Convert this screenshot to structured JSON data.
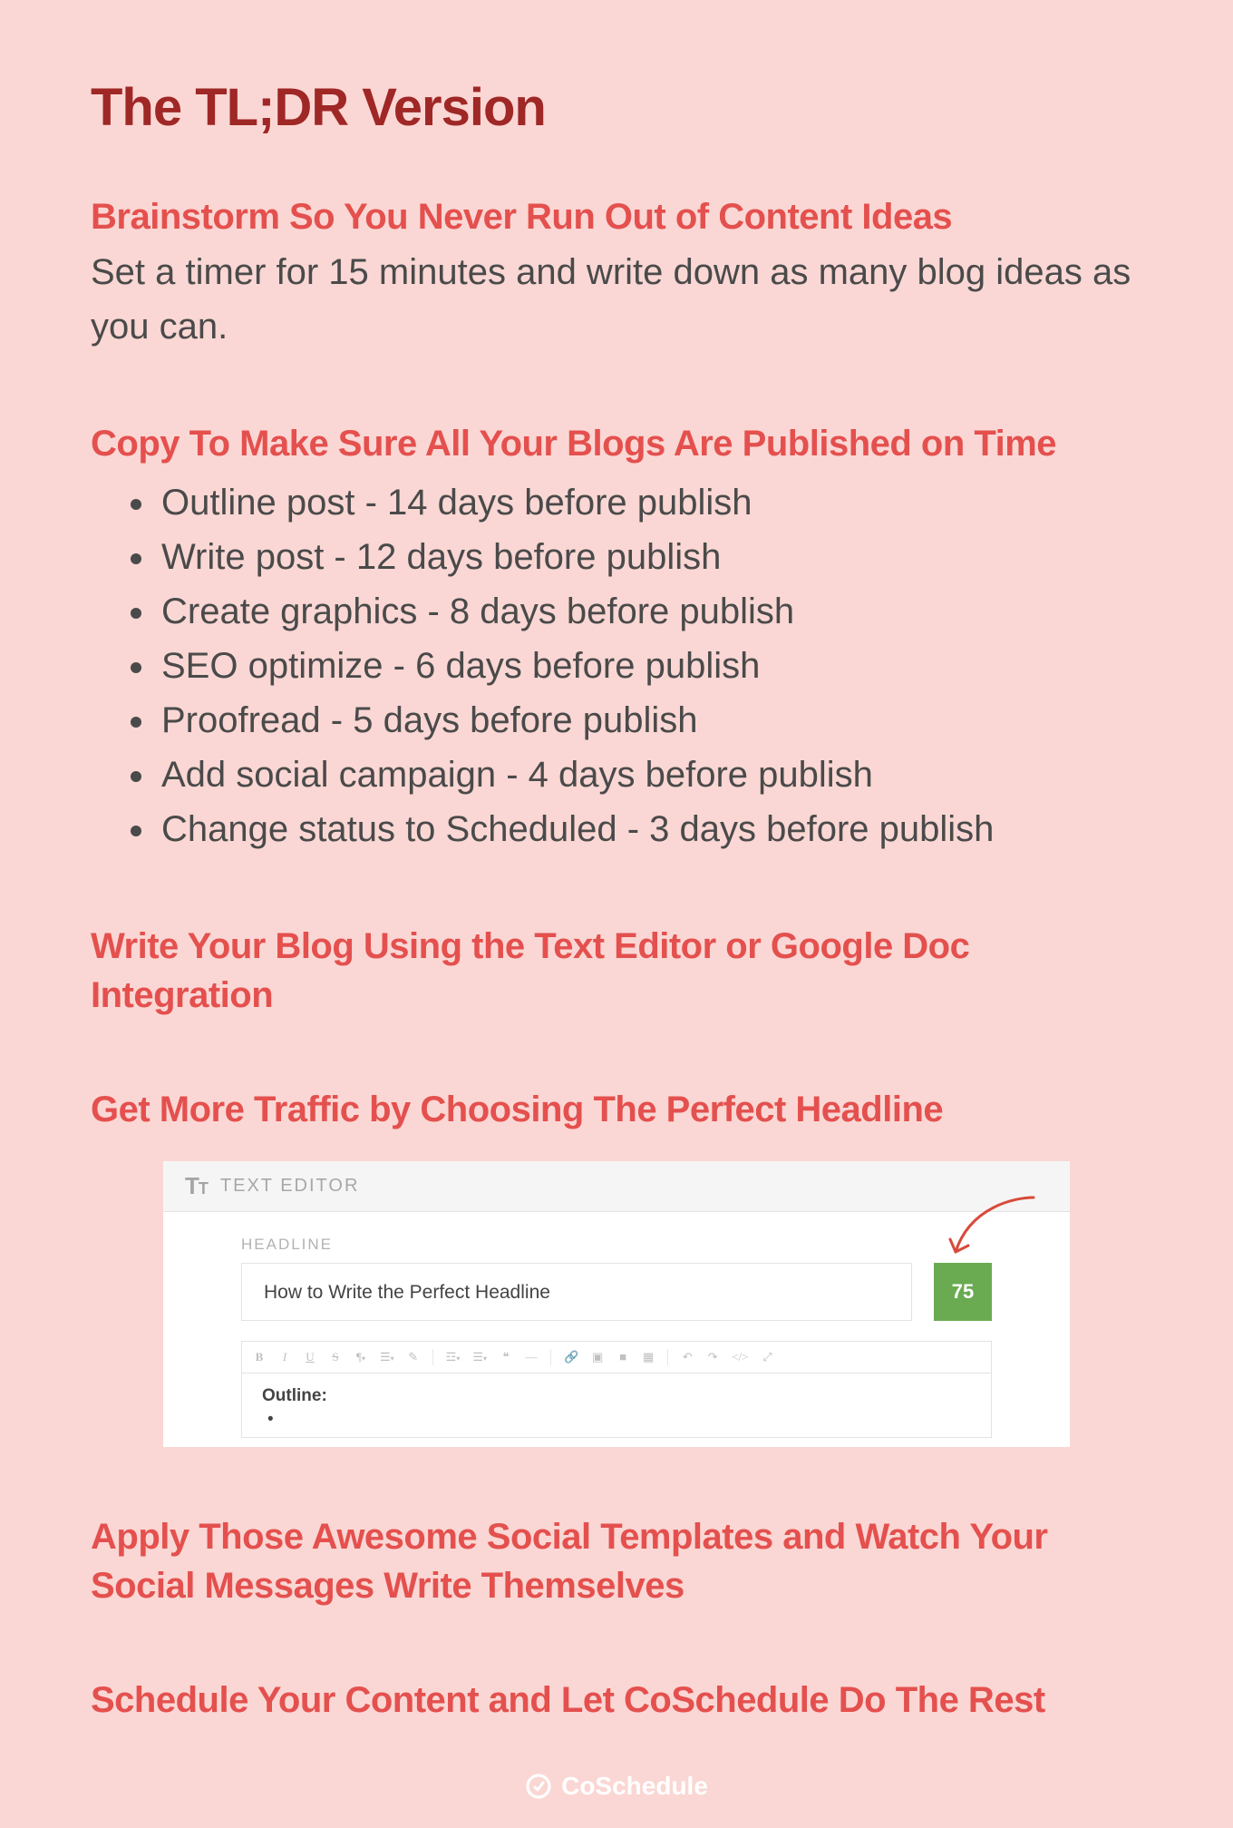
{
  "title": "The TL;DR Version",
  "sections": [
    {
      "heading": "Brainstorm So You Never Run Out of Content Ideas",
      "body": "Set a timer for 15 minutes and write down as many blog ideas as you can."
    },
    {
      "heading": "Copy To Make Sure All Your Blogs Are Published on Time",
      "list": [
        "Outline post - 14 days before publish",
        "Write post - 12 days before publish",
        "Create graphics - 8 days before publish",
        "SEO optimize - 6 days before publish",
        "Proofread - 5 days before publish",
        "Add social campaign - 4 days before publish",
        "Change status to Scheduled - 3 days before publish"
      ]
    },
    {
      "heading": "Write Your Blog Using the Text Editor or Google Doc Integration"
    },
    {
      "heading": "Get More Traffic by Choosing The Perfect Headline"
    },
    {
      "heading": "Apply Those Awesome Social Templates and Watch Your Social Messages Write Themselves"
    },
    {
      "heading": "Schedule Your Content and Let CoSchedule Do The Rest"
    }
  ],
  "editor": {
    "panel_label": "TEXT EDITOR",
    "headline_label": "HEADLINE",
    "headline_value": "How to Write the Perfect Headline",
    "score": "75",
    "outline_label": "Outline:",
    "outline_bullet": "•"
  },
  "brand": "CoSchedule"
}
